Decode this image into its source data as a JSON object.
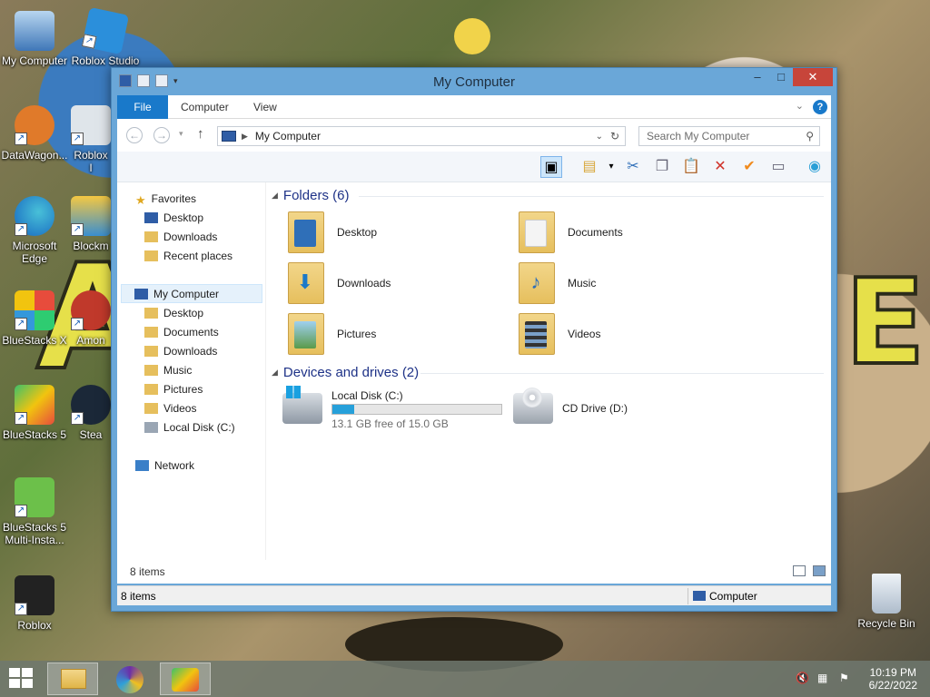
{
  "desktop": {
    "icons": [
      {
        "label": "My Computer"
      },
      {
        "label": "Roblox Studio"
      },
      {
        "label": "DataWagon..."
      },
      {
        "label": "Roblox I"
      },
      {
        "label": "Microsoft Edge"
      },
      {
        "label": "Blockm"
      },
      {
        "label": "BlueStacks X"
      },
      {
        "label": "Amon"
      },
      {
        "label": "BlueStacks 5"
      },
      {
        "label": "Stea"
      },
      {
        "label": "BlueStacks 5 Multi-Insta..."
      },
      {
        "label": "Roblox"
      },
      {
        "label": "Recycle Bin"
      }
    ]
  },
  "window": {
    "title": "My Computer",
    "controls": {
      "minimize": "–",
      "maximize": "□",
      "close": "✕"
    },
    "ribbon_tabs": [
      "File",
      "Computer",
      "View"
    ],
    "help": "?",
    "address": {
      "location": "My Computer"
    },
    "search": {
      "placeholder": "Search My Computer"
    },
    "nav": {
      "favorites": "Favorites",
      "favorites_items": [
        "Desktop",
        "Downloads",
        "Recent places"
      ],
      "computer": "My Computer",
      "computer_items": [
        "Desktop",
        "Documents",
        "Downloads",
        "Music",
        "Pictures",
        "Videos",
        "Local Disk (C:)"
      ],
      "network": "Network"
    },
    "groups": {
      "folders_header": "Folders (6)",
      "folders": [
        "Desktop",
        "Documents",
        "Downloads",
        "Music",
        "Pictures",
        "Videos"
      ],
      "devices_header": "Devices and drives (2)",
      "drives": [
        {
          "name": "Local Disk (C:)",
          "free": "13.1 GB free of 15.0 GB",
          "used_fraction": 0.127
        },
        {
          "name": "CD Drive (D:)"
        }
      ]
    },
    "status": {
      "items": "8 items",
      "bottom_items": "8 items",
      "bottom_location": "Computer"
    }
  },
  "taskbar": {
    "time": "10:19 PM",
    "date": "6/22/2022"
  },
  "colors": {
    "accent": "#1979ca",
    "window_frame": "#6aa7d8",
    "close": "#c7453a"
  }
}
